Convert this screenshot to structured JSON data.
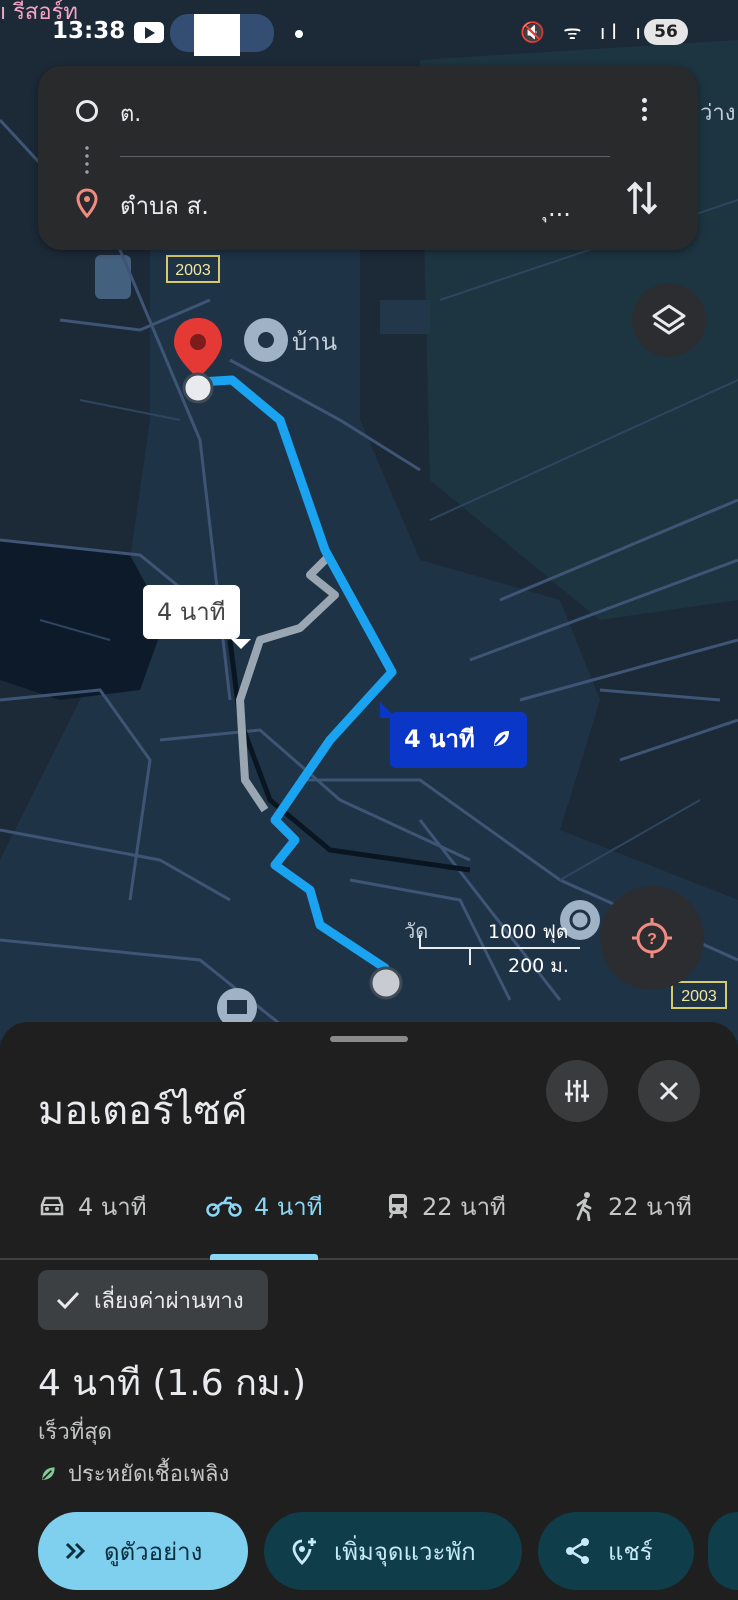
{
  "status_bar": {
    "corner_text": "ı รีสอร์ท",
    "time": "13:38",
    "icons": "🔇 ᯤ ıl ıl",
    "battery": "56"
  },
  "search": {
    "origin_text": "ต.",
    "destination_text": "ตำบล ส.",
    "destination_text_end": "ุ...",
    "menu_icon": "more-vert-icon",
    "swap_icon": "swap-vert-icon"
  },
  "map": {
    "road_badge_top": "2003",
    "road_badge_bottom": "2003",
    "place_home": "บ้าน",
    "place_right_edge": "ว่าง",
    "place_temple": "วัด",
    "scale_feet": "1000 ฟุต",
    "scale_meters": "200 ม.",
    "alt_route_label": "4 นาที",
    "main_route_label": "4 นาที",
    "main_route_icon": "leaf-icon",
    "colors": {
      "background": "#1c2a38",
      "route_main": "#1aa3f0",
      "route_alt": "#9aa7b2",
      "pin": "#e53935"
    }
  },
  "sheet": {
    "title": "มอเตอร์ไซค์",
    "modes": [
      {
        "icon": "car-icon",
        "label": "4 นาที",
        "active": false
      },
      {
        "icon": "motorcycle-icon",
        "label": "4 นาที",
        "active": true
      },
      {
        "icon": "transit-icon",
        "label": "22 นาที",
        "active": false
      },
      {
        "icon": "walk-icon",
        "label": "22 นาที",
        "active": false
      }
    ],
    "toll_chip": "เลี่ยงค่าผ่านทาง",
    "duration": "4 นาที (1.6 กม.)",
    "fastest": "เร็วที่สุด",
    "eco": "ประหยัดเชื้อเพลิง",
    "actions": {
      "preview": "ดูตัวอย่าง",
      "add_stop": "เพิ่มจุดแวะพัก",
      "share": "แชร์"
    },
    "accent_color": "#8ad6f5"
  }
}
